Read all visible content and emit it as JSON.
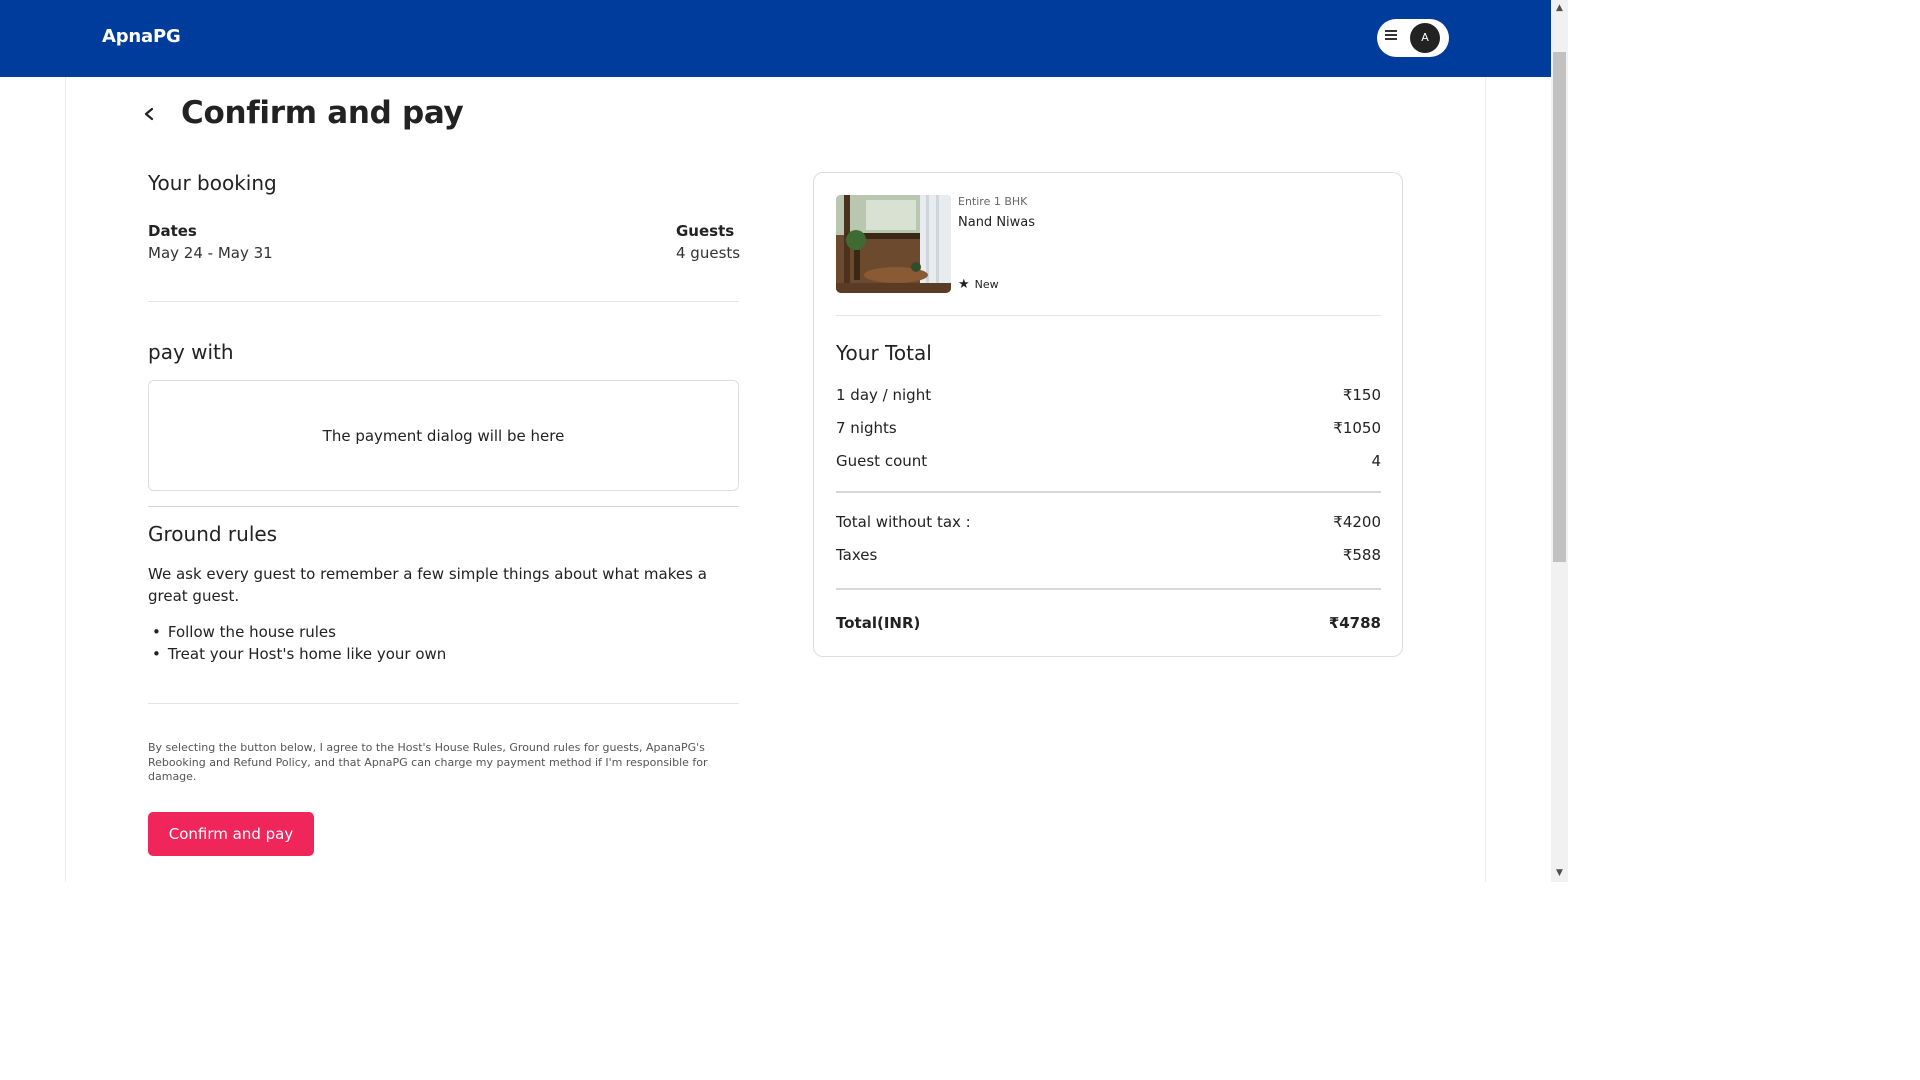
{
  "header": {
    "brand": "ApnaPG",
    "avatar_initial": "A",
    "nav_color": "#003c9c"
  },
  "page": {
    "title": "Confirm and pay"
  },
  "booking": {
    "section_title": "Your booking",
    "dates_label": "Dates",
    "dates_value": "May 24 - May 31",
    "guests_label": "Guests",
    "guests_value": "4 guests"
  },
  "payment": {
    "section_title": "pay with",
    "placeholder": "The payment dialog will be here"
  },
  "rules": {
    "section_title": "Ground rules",
    "description": "We ask every guest to remember a few simple things about what makes a great guest.",
    "items": [
      "Follow the house rules",
      "Treat your Host's home like your own"
    ]
  },
  "legal_text": "By selecting the button below, I agree to the Host's House Rules, Ground rules for guests, ApanaPG's Rebooking and Refund Policy, and that ApnaPG can charge my payment method if I'm responsible for damage.",
  "confirm_button": {
    "label": "Confirm and pay",
    "color": "#f0265b"
  },
  "summary": {
    "listing_type": "Entire 1 BHK",
    "listing_name": "Nand Niwas",
    "rating_label": "New",
    "total_title": "Your Total",
    "rows": [
      {
        "label": "1 day / night",
        "value": "₹150"
      },
      {
        "label": "7 nights",
        "value": "₹1050"
      },
      {
        "label": "Guest count",
        "value": "4"
      }
    ],
    "subtotal_rows": [
      {
        "label": "Total without tax :",
        "value": "₹4200"
      },
      {
        "label": "Taxes",
        "value": "₹588"
      }
    ],
    "grand_total": {
      "label": "Total(INR)",
      "value": "₹4788"
    }
  }
}
